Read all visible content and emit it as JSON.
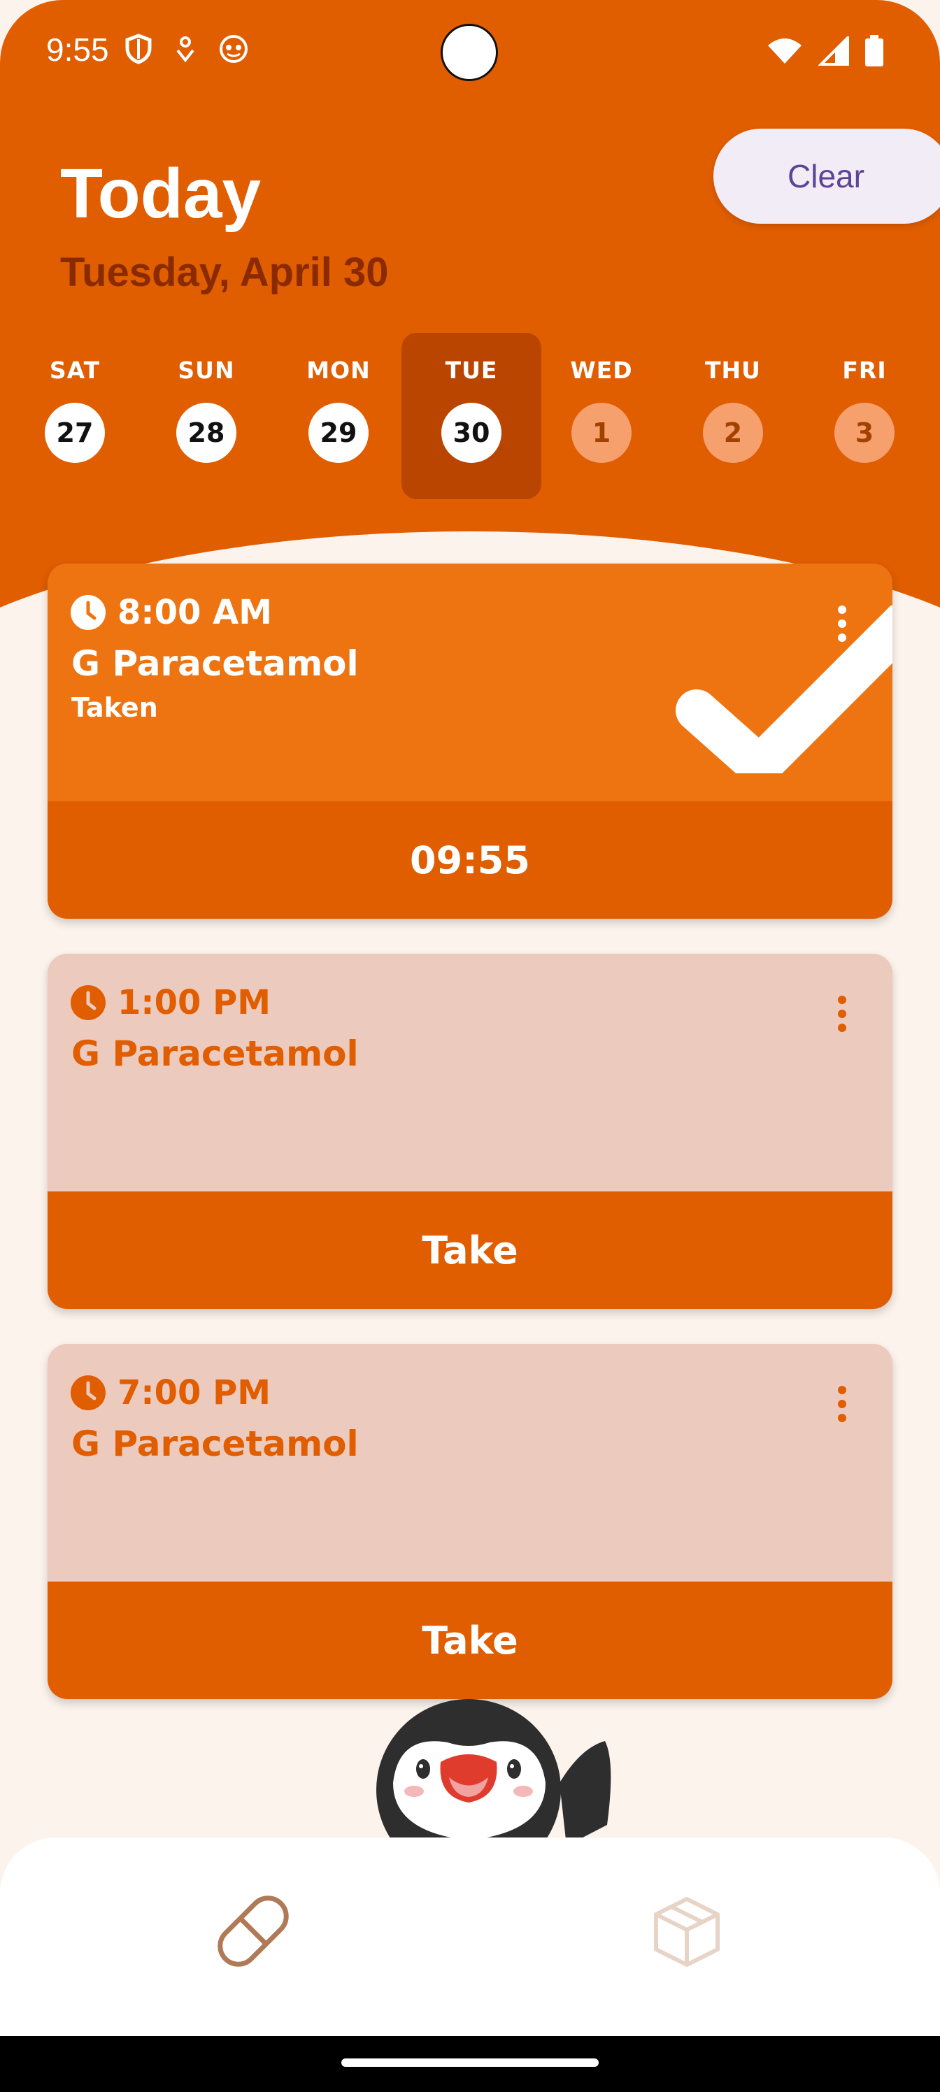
{
  "status_bar": {
    "time": "9:55",
    "left_icons": [
      "shield-icon",
      "location-pin-icon",
      "app-face-icon"
    ],
    "right_icons": [
      "wifi-icon",
      "signal-icon",
      "battery-icon"
    ]
  },
  "header": {
    "title": "Today",
    "date": "Tuesday, April 30",
    "clear_label": "Clear"
  },
  "week": [
    {
      "name": "SAT",
      "num": "27",
      "state": "past"
    },
    {
      "name": "SUN",
      "num": "28",
      "state": "past"
    },
    {
      "name": "MON",
      "num": "29",
      "state": "past"
    },
    {
      "name": "TUE",
      "num": "30",
      "state": "selected"
    },
    {
      "name": "WED",
      "num": "1",
      "state": "future"
    },
    {
      "name": "THU",
      "num": "2",
      "state": "future"
    },
    {
      "name": "FRI",
      "num": "3",
      "state": "future"
    }
  ],
  "doses": [
    {
      "time": "8:00 AM",
      "medication": "G Paracetamol",
      "status": "Taken",
      "action": "09:55"
    },
    {
      "time": "1:00 PM",
      "medication": "G Paracetamol",
      "status": "",
      "action": "Take"
    },
    {
      "time": "7:00 PM",
      "medication": "G Paracetamol",
      "status": "",
      "action": "Take"
    }
  ],
  "bottom_nav": {
    "items": [
      "pill-icon",
      "box-icon"
    ]
  },
  "colors": {
    "accent": "#E05D00",
    "taken_card": "#EE7412",
    "pending_card": "#ECCABD",
    "background": "#FCF3EC",
    "clear_button_text": "#5A4596"
  }
}
